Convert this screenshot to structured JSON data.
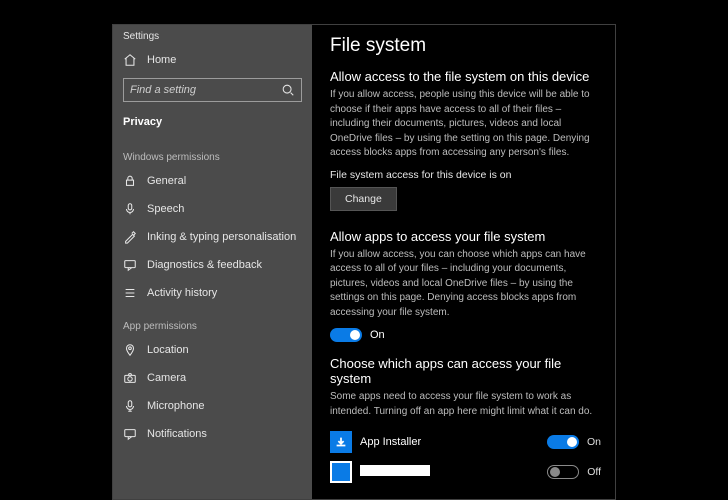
{
  "window": {
    "title": "Settings"
  },
  "sidebar": {
    "home_label": "Home",
    "search_placeholder": "Find a setting",
    "selected_category": "Privacy",
    "group_windows": "Windows permissions",
    "items_windows": [
      {
        "label": "General"
      },
      {
        "label": "Speech"
      },
      {
        "label": "Inking & typing personalisation"
      },
      {
        "label": "Diagnostics & feedback"
      },
      {
        "label": "Activity history"
      }
    ],
    "group_app": "App permissions",
    "items_app": [
      {
        "label": "Location"
      },
      {
        "label": "Camera"
      },
      {
        "label": "Microphone"
      },
      {
        "label": "Notifications"
      }
    ]
  },
  "main": {
    "page_title": "File system",
    "section1": {
      "heading": "Allow access to the file system on this device",
      "desc": "If you allow access, people using this device will be able to choose if their apps have access to all of their files – including their documents, pictures, videos and local OneDrive files – by using the setting on this page. Denying access blocks apps from accessing any person's files.",
      "status": "File system access for this device is on",
      "change_button": "Change"
    },
    "section2": {
      "heading": "Allow apps to access your file system",
      "desc": "If you allow access, you can choose which apps can have access to all of your files – including your documents, pictures, videos and local OneDrive files – by using the settings on this page. Denying access blocks apps from accessing your file system.",
      "toggle_label": "On"
    },
    "section3": {
      "heading": "Choose which apps can access your file system",
      "desc": "Some apps need to access your file system to work as intended. Turning off an app here might limit what it can do.",
      "apps": [
        {
          "name": "App Installer",
          "state": "On"
        },
        {
          "name": "",
          "state": "Off"
        }
      ]
    }
  }
}
